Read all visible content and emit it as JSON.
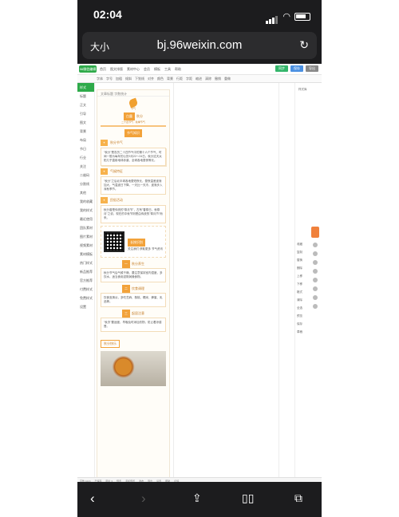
{
  "status_bar": {
    "time": "02:04"
  },
  "browser": {
    "text_size": "大小",
    "url": "bj.96weixin.com",
    "reload_icon": "reload-icon"
  },
  "toolbar": {
    "logo": "96微信编辑器",
    "menu": [
      "首页",
      "图文排版",
      "素材中心",
      "会员",
      "模板",
      "工具",
      "帮助"
    ],
    "buttons": [
      "同步",
      "保存",
      "导出"
    ]
  },
  "toolbar2": {
    "items": [
      "字体",
      "字号",
      "加粗",
      "倾斜",
      "下划线",
      "对齐",
      "颜色",
      "背景",
      "行距",
      "字距",
      "缩进",
      "清除",
      "撤销",
      "重做"
    ]
  },
  "sidebar": {
    "active": "样式",
    "items": [
      "标题",
      "正文",
      "引导",
      "图文",
      "背景",
      "布局",
      "节日",
      "行业",
      "关注",
      "二维码",
      "分割线",
      "其他",
      "我的收藏",
      "我的样式",
      "最近使用",
      "团队素材",
      "图片素材",
      "视频素材",
      "素材模板",
      "热门样式",
      "新品推荐",
      "官方推荐",
      "付费样式",
      "免费样式",
      "设置"
    ]
  },
  "article": {
    "header": "文章标题 字数统计",
    "brand_small": "节气",
    "hero_badge": "白露",
    "hero_title": "秋分",
    "hero_sub": "二十四节气 · 秋季节气",
    "sec1_badge": "节气知识",
    "sec1_title": "秋分节气",
    "para1": "\"秋分\"是农历二十四节气中的第十六个节气，时间一般为每年的公历9月22～24日。秋分这天太阳几乎直射地球赤道，全球各地昼夜等长。",
    "sec2_title": "气候特征",
    "para2": "\"秋分\"之后北半球各地昼短夜长，昼夜温差逐渐加大，气温逐日下降，一天比一天冷，逐渐步入深秋季节。",
    "sec3_title": "民俗活动",
    "para3": "秋分曾是传统的\"祭月节\"，古有\"春祭日，秋祭月\"之说。现在的中秋节则是由传统的\"祭月节\"而来。",
    "qr_btn": "长按识别",
    "qr_text": "关注我们 获取更多 节气资讯",
    "sec4_badge": "一",
    "sec4_title": "秋分养生",
    "para4": "秋分节气后气候干燥，要注意保持室内湿度，多饮水，适当食用滋阴润燥食物。",
    "sec5_badge": "二",
    "sec5_title": "饮食调理",
    "para5": "饮食宜清淡，多吃芝麻、核桃、糯米、蜂蜜、乳品等。",
    "sec6_badge": "三",
    "sec6_title": "起居注意",
    "para6": "\"秋冻\"要适度，早晚及时添加衣物，防止着凉感冒。",
    "bottom_badge": "秋分快乐"
  },
  "right_panel": {
    "label": "样式库",
    "items": [
      "收藏",
      "复制",
      "替换",
      "删除",
      "上移",
      "下移",
      "格式",
      "清除",
      "全选",
      "预览",
      "保存",
      "草稿"
    ]
  },
  "bottom_status": {
    "items": [
      "字数 1024",
      "已保存",
      "图片 3",
      "预览",
      "手机预览",
      "发布",
      "导出",
      "设置",
      "帮助",
      "反馈"
    ]
  },
  "safari": {
    "back": "back-icon",
    "forward": "forward-icon",
    "share": "share-icon",
    "bookmarks": "book-icon",
    "tabs": "tabs-icon"
  }
}
